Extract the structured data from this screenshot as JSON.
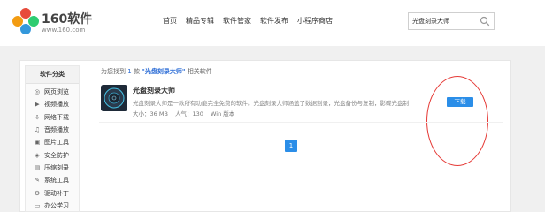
{
  "logo": {
    "name": "160软件",
    "url": "www.160.com"
  },
  "nav": [
    "首页",
    "精品专辑",
    "软件管家",
    "软件发布",
    "小程序商店"
  ],
  "search": {
    "value": "光盘刻录大师",
    "icon": "search-icon"
  },
  "sidebar": {
    "title": "软件分类",
    "items": [
      {
        "label": "网页浏览",
        "icon": "globe-icon"
      },
      {
        "label": "视频播放",
        "icon": "play-icon"
      },
      {
        "label": "网络下载",
        "icon": "download-icon"
      },
      {
        "label": "音频播放",
        "icon": "music-icon"
      },
      {
        "label": "图片工具",
        "icon": "image-icon"
      },
      {
        "label": "安全防护",
        "icon": "shield-icon"
      },
      {
        "label": "压缩刻录",
        "icon": "archive-icon"
      },
      {
        "label": "系统工具",
        "icon": "wrench-icon"
      },
      {
        "label": "驱动补丁",
        "icon": "plug-icon"
      },
      {
        "label": "办公学习",
        "icon": "book-icon"
      }
    ]
  },
  "result": {
    "prefix": "为您找到",
    "count": "1",
    "unit": "款",
    "keyword": "\"光盘刻录大师\"",
    "suffix": "相关软件"
  },
  "software": {
    "name": "光盘刻录大师",
    "description": "光盘刻录大师是一款所有功能完全免费的软件。光盘刻录大师涵盖了数据刻录，光盘备份与复制，影碟光盘制作，音乐光...",
    "size": "大小：36 MB",
    "popularity": "人气：130",
    "platform": "Win 版本",
    "download_label": "下载"
  },
  "pagination": {
    "current": "1"
  },
  "colors": {
    "accent": "#2b8ee8",
    "annotation": "#e53935"
  }
}
